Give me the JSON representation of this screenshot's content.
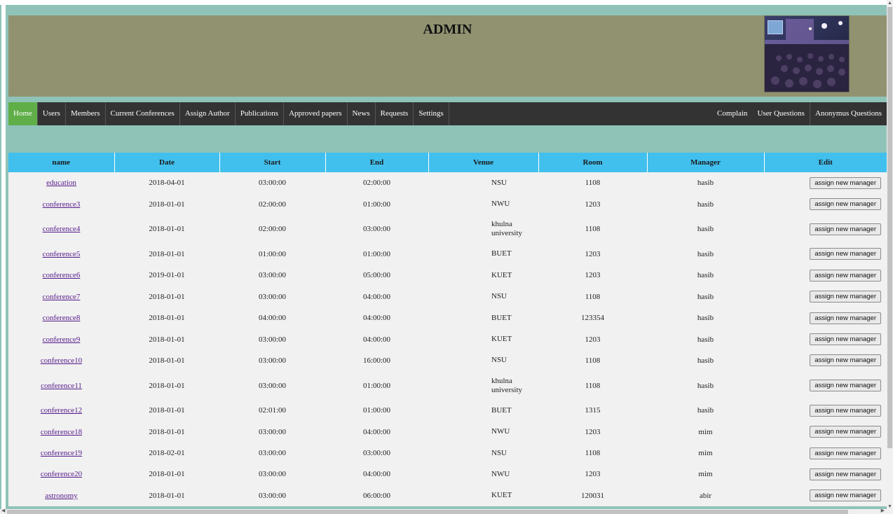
{
  "header": {
    "title": "ADMIN"
  },
  "nav": {
    "left": [
      {
        "label": "Home",
        "active": true
      },
      {
        "label": "Users"
      },
      {
        "label": "Members"
      },
      {
        "label": "Current Conferences"
      },
      {
        "label": "Assign Author"
      },
      {
        "label": "Publications"
      },
      {
        "label": "Approved papers"
      },
      {
        "label": "News"
      },
      {
        "label": "Requests"
      },
      {
        "label": "Settings"
      }
    ],
    "right": [
      {
        "label": "Complain"
      },
      {
        "label": "User Questions"
      },
      {
        "label": "Anonymus Questions"
      }
    ]
  },
  "table": {
    "headers": [
      "name",
      "Date",
      "Start",
      "End",
      "Venue",
      "Room",
      "Manager",
      "Edit"
    ],
    "button_label": "assign new manager",
    "rows": [
      {
        "name": "education",
        "date": "2018-04-01",
        "start": "03:00:00",
        "end": "02:00:00",
        "venue": "NSU",
        "room": "1108",
        "manager": "hasib"
      },
      {
        "name": "conference3",
        "date": "2018-01-01",
        "start": "02:00:00",
        "end": "01:00:00",
        "venue": "NWU",
        "room": "1203",
        "manager": "hasib"
      },
      {
        "name": "conference4",
        "date": "2018-01-01",
        "start": "02:00:00",
        "end": "03:00:00",
        "venue": "khulna university",
        "room": "1108",
        "manager": "hasib"
      },
      {
        "name": "conference5",
        "date": "2018-01-01",
        "start": "01:00:00",
        "end": "01:00:00",
        "venue": "BUET",
        "room": "1203",
        "manager": "hasib"
      },
      {
        "name": "conference6",
        "date": "2019-01-01",
        "start": "03:00:00",
        "end": "05:00:00",
        "venue": "KUET",
        "room": "1203",
        "manager": "hasib"
      },
      {
        "name": "conference7",
        "date": "2018-01-01",
        "start": "03:00:00",
        "end": "04:00:00",
        "venue": "NSU",
        "room": "1108",
        "manager": "hasib"
      },
      {
        "name": "conference8",
        "date": "2018-01-01",
        "start": "04:00:00",
        "end": "04:00:00",
        "venue": "BUET",
        "room": "123354",
        "manager": "hasib"
      },
      {
        "name": "conference9",
        "date": "2018-01-01",
        "start": "03:00:00",
        "end": "04:00:00",
        "venue": "KUET",
        "room": "1203",
        "manager": "hasib"
      },
      {
        "name": "conference10",
        "date": "2018-01-01",
        "start": "03:00:00",
        "end": "16:00:00",
        "venue": "NSU",
        "room": "1108",
        "manager": "hasib"
      },
      {
        "name": "conference11",
        "date": "2018-01-01",
        "start": "03:00:00",
        "end": "01:00:00",
        "venue": "khulna university",
        "room": "1108",
        "manager": "hasib"
      },
      {
        "name": "conference12",
        "date": "2018-01-01",
        "start": "02:01:00",
        "end": "01:00:00",
        "venue": "BUET",
        "room": "1315",
        "manager": "hasib"
      },
      {
        "name": "conference18",
        "date": "2018-01-01",
        "start": "03:00:00",
        "end": "04:00:00",
        "venue": "NWU",
        "room": "1203",
        "manager": "mim"
      },
      {
        "name": "conference19",
        "date": "2018-02-01",
        "start": "03:00:00",
        "end": "03:00:00",
        "venue": "NSU",
        "room": "1108",
        "manager": "mim"
      },
      {
        "name": "conference20",
        "date": "2018-01-01",
        "start": "03:00:00",
        "end": "04:00:00",
        "venue": "NWU",
        "room": "1203",
        "manager": "mim"
      },
      {
        "name": "astronomy",
        "date": "2018-01-01",
        "start": "03:00:00",
        "end": "06:00:00",
        "venue": "KUET",
        "room": "120031",
        "manager": "abir"
      }
    ]
  }
}
